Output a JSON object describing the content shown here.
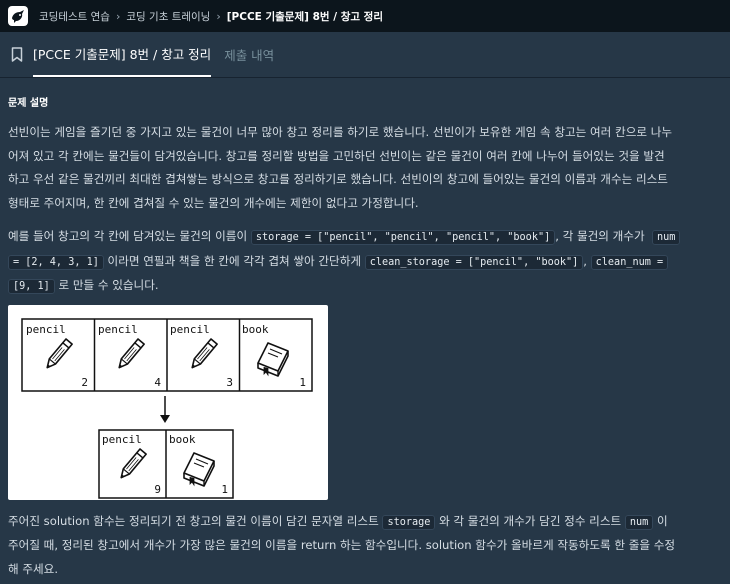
{
  "header": {
    "breadcrumbs": [
      "코딩테스트 연습",
      "코딩 기초 트레이닝",
      "[PCCE 기출문제] 8번 / 창고 정리"
    ]
  },
  "tabs": [
    {
      "label": "[PCCE 기출문제] 8번 / 창고 정리",
      "active": true
    },
    {
      "label": "제출 내역",
      "active": false
    }
  ],
  "problem": {
    "section_title": "문제 설명",
    "p1_lines": [
      "선빈이는 게임을 즐기던 중 가지고 있는 물건이 너무 많아 창고 정리를 하기로 했습니다. 선빈이가 보유한 게임 속 창고는 여러 칸으로 나누",
      "어져 있고 각 칸에는 물건들이 담겨있습니다. 창고를 정리할 방법을 고민하던 선빈이는 같은 물건이 여러 칸에 나누어 들어있는 것을 발견",
      "하고 우선 같은 물건끼리 최대한 겹쳐쌓는 방식으로 창고를 정리하기로 했습니다. 선빈이의 창고에 들어있는 물건의 이름과 개수는 리스트",
      "형태로 주어지며, 한 칸에 겹쳐질 수 있는 물건의 개수에는 제한이 없다고 가정합니다."
    ],
    "p2": {
      "t1": "예를 들어 창고의 각 칸에 담겨있는 물건의 이름이 ",
      "c1": "storage = [\"pencil\", \"pencil\", \"pencil\", \"book\"]",
      "t2": ", 각 물건의 개수가 ",
      "c2a": "num",
      "c2b": "= [2, 4, 3, 1]",
      "t3": " 이라면 연필과 책을 한 칸에 각각 겹쳐 쌓아 간단하게 ",
      "c3": "clean_storage = [\"pencil\", \"book\"]",
      "t4": ", ",
      "c4a": "clean_num =",
      "c4b": "[9, 1]",
      "t5": " 로 만들 수 있습니다."
    },
    "figure": {
      "top_cells": [
        {
          "item": "pencil",
          "count": "2"
        },
        {
          "item": "pencil",
          "count": "4"
        },
        {
          "item": "pencil",
          "count": "3"
        },
        {
          "item": "book",
          "count": "1"
        }
      ],
      "bottom_cells": [
        {
          "item": "pencil",
          "count": "9"
        },
        {
          "item": "book",
          "count": "1"
        }
      ]
    },
    "p3": {
      "t1": "주어진 solution 함수는 정리되기 전 창고의 물건 이름이 담긴 문자열 리스트 ",
      "c1": "storage",
      "t2": " 와 각 물건의 개수가 담긴 정수 리스트 ",
      "c2": "num",
      "t3": " 이",
      "line2": "주어질 때, 정리된 창고에서 개수가 가장 많은 물건의 이름을 return 하는 함수입니다. solution 함수가 올바르게 작동하도록 한 줄을 수정",
      "line3": "해 주세요."
    }
  },
  "colors": {
    "background": "#263747",
    "topbar": "#0c151c",
    "active_tab": "#ffffff",
    "inactive_tab": "#78909c"
  }
}
